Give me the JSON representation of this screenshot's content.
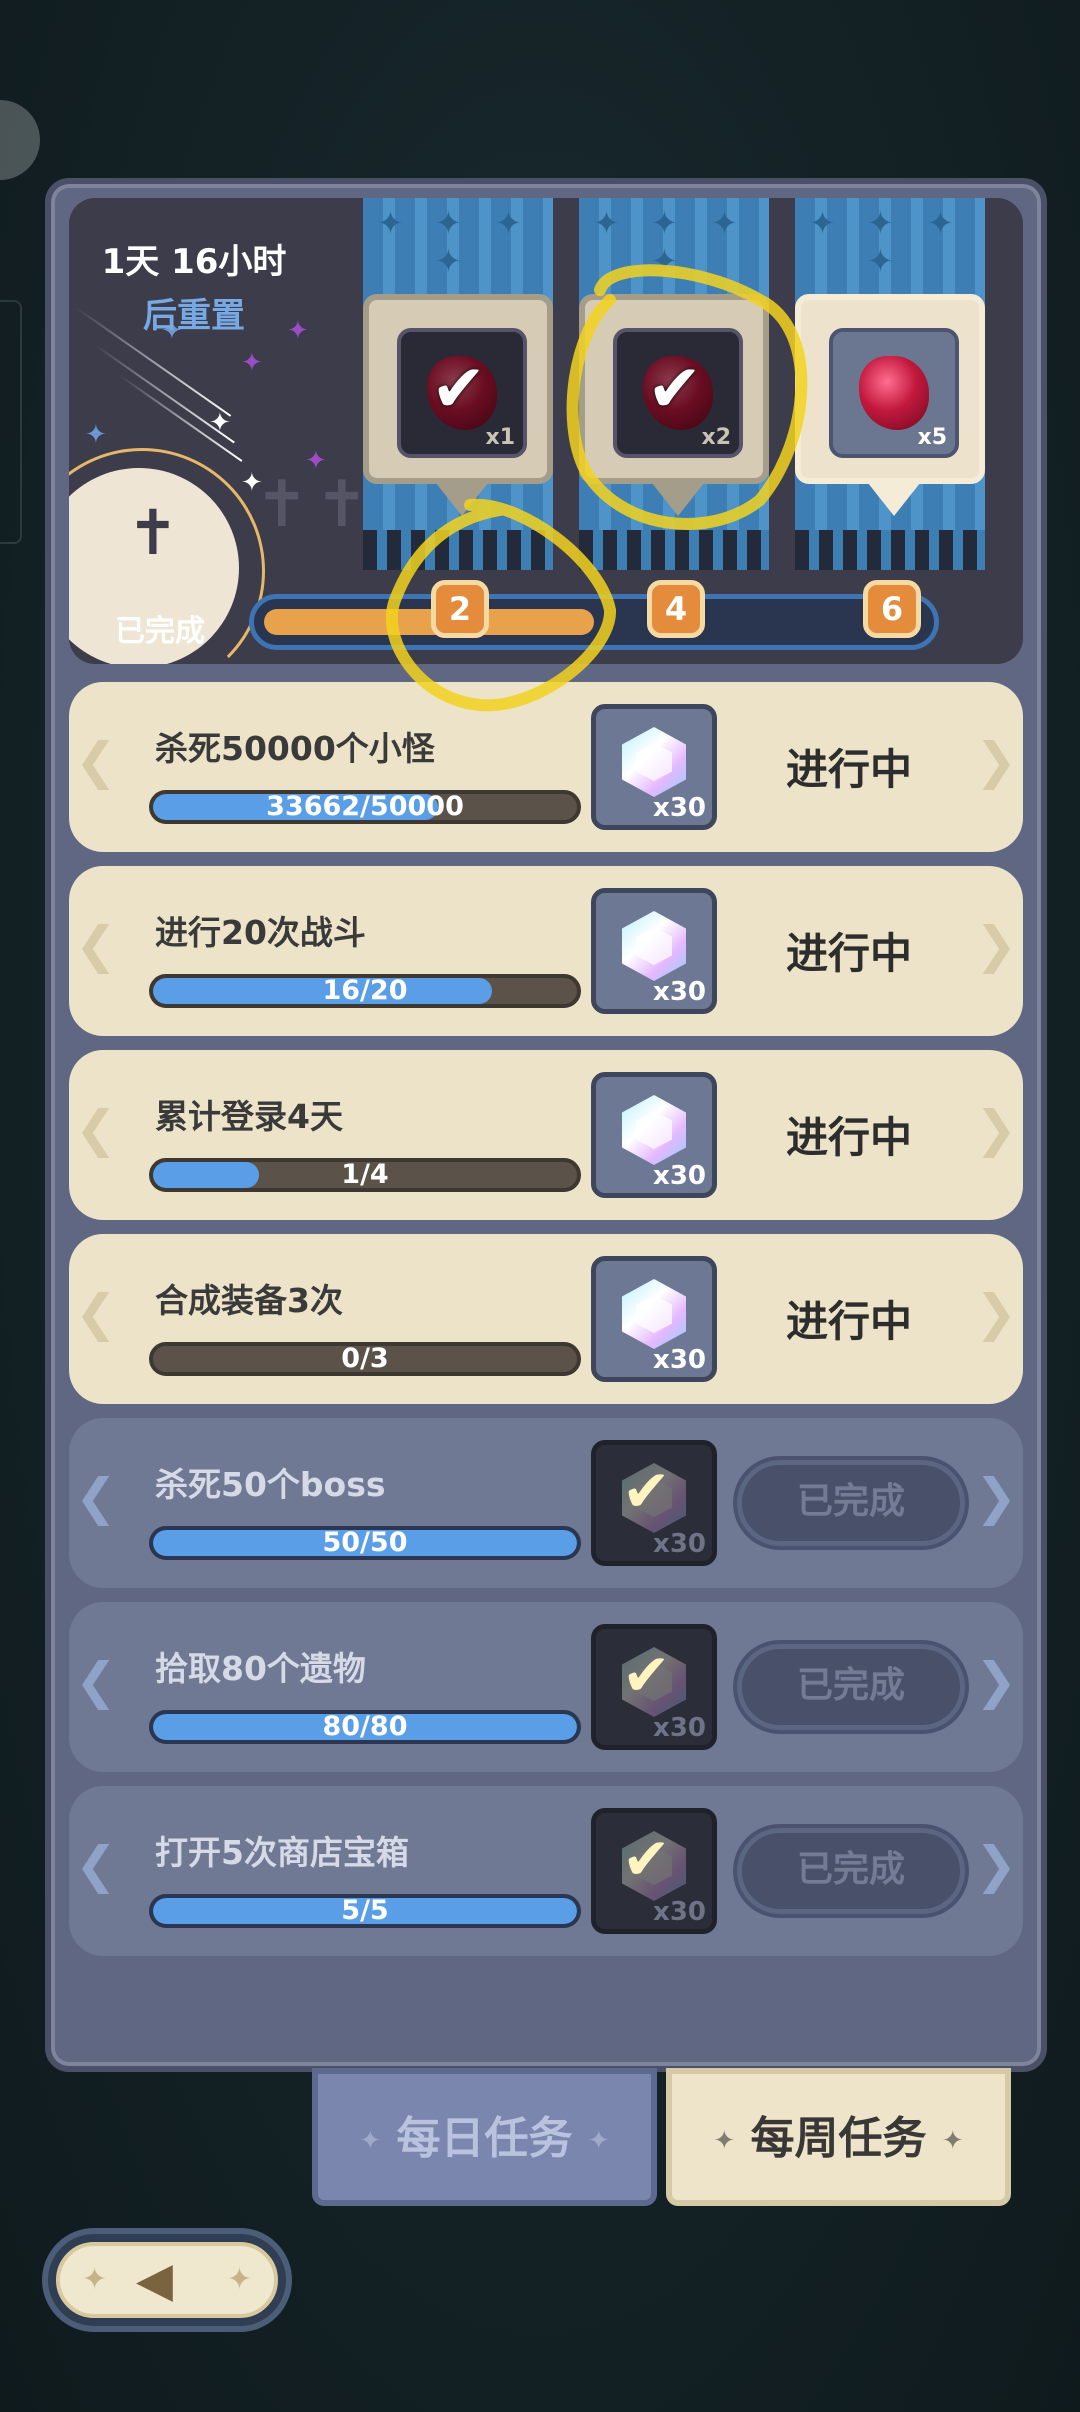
{
  "header": {
    "timer": "1天 16小时",
    "reset_label": "后重置",
    "completed_label": "已完成"
  },
  "milestones": [
    {
      "threshold": "2",
      "reward_qty": "x1",
      "claimed": true
    },
    {
      "threshold": "4",
      "reward_qty": "x2",
      "claimed": true
    },
    {
      "threshold": "6",
      "reward_qty": "x5",
      "claimed": false
    }
  ],
  "progress": {
    "completed": 3,
    "max": 6
  },
  "tasks": [
    {
      "name": "杀死50000个小怪",
      "progress_text": "33662/50000",
      "fraction": 0.673,
      "reward_qty": "x30",
      "status": "进行中",
      "done": false
    },
    {
      "name": "进行20次战斗",
      "progress_text": "16/20",
      "fraction": 0.8,
      "reward_qty": "x30",
      "status": "进行中",
      "done": false
    },
    {
      "name": "累计登录4天",
      "progress_text": "1/4",
      "fraction": 0.25,
      "reward_qty": "x30",
      "status": "进行中",
      "done": false
    },
    {
      "name": "合成装备3次",
      "progress_text": "0/3",
      "fraction": 0.0,
      "reward_qty": "x30",
      "status": "进行中",
      "done": false
    },
    {
      "name": "杀死50个boss",
      "progress_text": "50/50",
      "fraction": 1.0,
      "reward_qty": "x30",
      "status": "已完成",
      "done": true
    },
    {
      "name": "拾取80个遗物",
      "progress_text": "80/80",
      "fraction": 1.0,
      "reward_qty": "x30",
      "status": "已完成",
      "done": true
    },
    {
      "name": "打开5次商店宝箱",
      "progress_text": "5/5",
      "fraction": 1.0,
      "reward_qty": "x30",
      "status": "已完成",
      "done": true
    }
  ],
  "tabs": {
    "daily": "每日任务",
    "weekly": "每周任务"
  },
  "colors": {
    "accent_orange": "#e58b3c",
    "progress_blue": "#5a9ee8",
    "highlight_yellow": "#f2d21e"
  }
}
